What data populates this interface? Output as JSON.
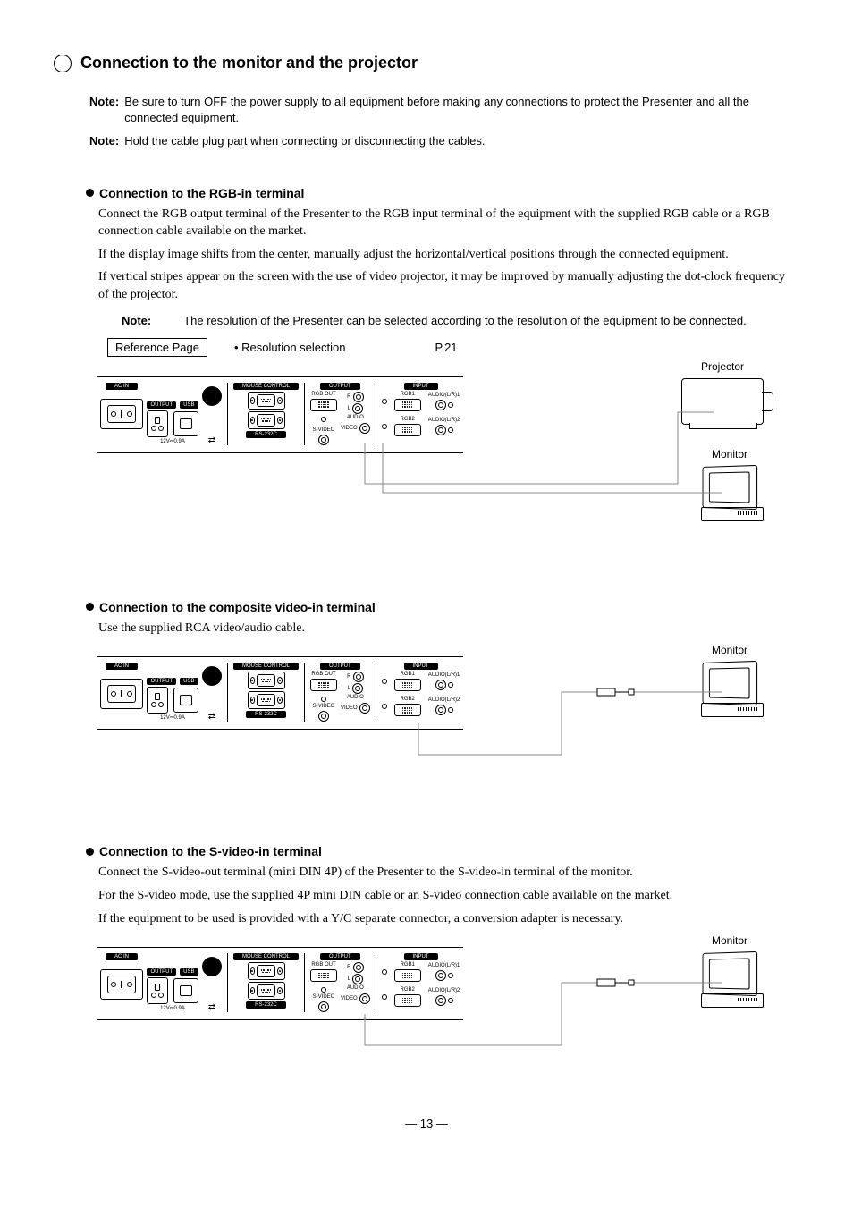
{
  "heading": "Connection to the monitor and the projector",
  "note1": "Be sure to turn OFF the power supply to all equipment before making any connections to protect the Presenter and all the connected equipment.",
  "note2": "Hold the cable plug part when connecting or disconnecting the cables.",
  "noteLabel": "Note:",
  "section1": {
    "title": "Connection to the RGB-in terminal",
    "p1": "Connect the RGB output terminal of the Presenter to the RGB input terminal of the equipment with the supplied RGB cable or a RGB connection cable available on the market.",
    "p2": "If the display image shifts from the center, manually adjust the horizontal/vertical positions through the connected equipment.",
    "p3": "If vertical stripes appear on the screen with the use of video projector, it may be improved by manually adjusting the dot-clock frequency of the projector.",
    "note": "The resolution of the Presenter can be selected according to the resolution of the equipment to be connected.",
    "refBox": "Reference Page",
    "refItem": "• Resolution selection",
    "refPage": "P.21"
  },
  "section2": {
    "title": "Connection to the composite video-in terminal",
    "p1": "Use the supplied RCA video/audio cable."
  },
  "section3": {
    "title": "Connection to the S-video-in terminal",
    "p1": "Connect the S-video-out terminal (mini DIN 4P) of the Presenter to the S-video-in terminal of the monitor.",
    "p2": "For the S-video mode, use the supplied 4P mini DIN cable or an S-video connection cable available on the market.",
    "p3": "If the equipment to be used is provided with a Y/C separate connector, a conversion adapter is necessary."
  },
  "panel": {
    "acin": "AC IN",
    "output": "OUTPUT",
    "usb": "USB",
    "volt": "12V⎓0.9A",
    "mouse": "MOUSE CONTROL",
    "rs232c": "RS-232C",
    "outputSection": "OUTPUT",
    "rgbout": "RGB OUT",
    "svideo": "S-VIDEO",
    "audio": "AUDIO",
    "r": "R",
    "l": "L",
    "video": "VIDEO",
    "input": "INPUT",
    "rgb1": "RGB1",
    "rgb2": "RGB2",
    "audio1": "AUDIO(L/R)1",
    "audio2": "AUDIO(L/R)2"
  },
  "devices": {
    "projector": "Projector",
    "monitor": "Monitor"
  },
  "pageNum": "13"
}
